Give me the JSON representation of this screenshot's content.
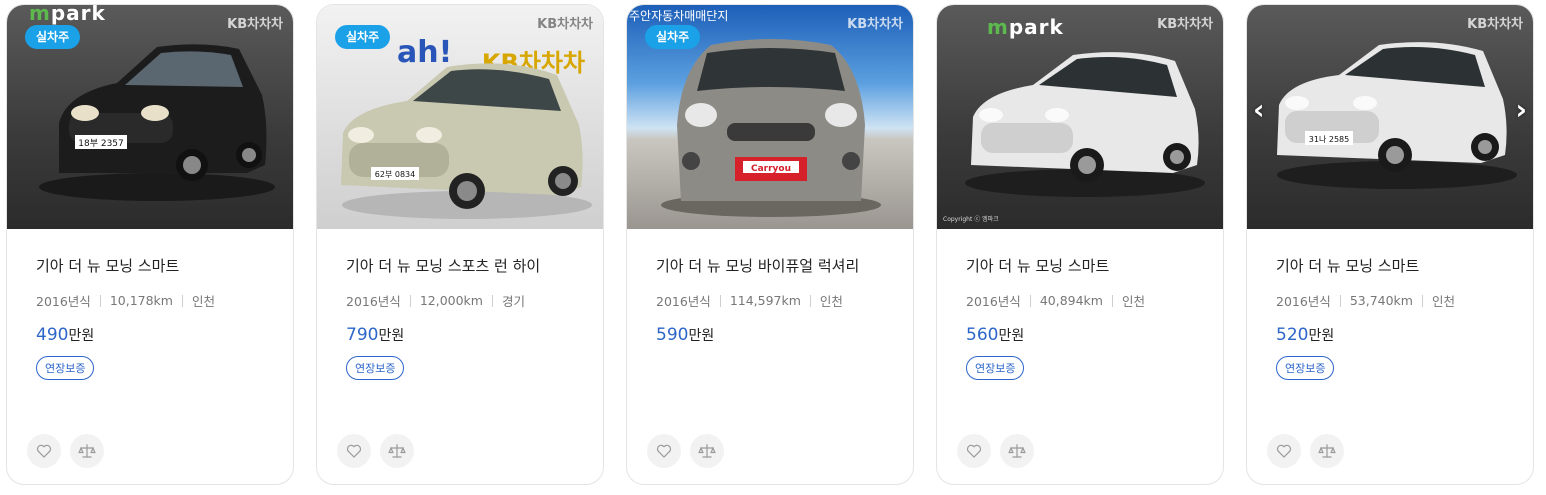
{
  "cards": [
    {
      "badge": "실차주",
      "photo_brand_green": "m",
      "photo_brand_rest": "park",
      "photo_kb": "KB차차차",
      "plate": "18부 2357",
      "title": "기아 더 뉴 모닝 스마트",
      "year": "2016년식",
      "mileage": "10,178km",
      "region": "인천",
      "price": "490",
      "price_unit": "만원",
      "tag": "연장보증",
      "car_color": "#1c1c1c"
    },
    {
      "badge": "실차주",
      "photo_sign_dealer": "ah!",
      "photo_sign_kb": "KB차차차",
      "photo_kb": "KB차차차",
      "plate": "62부 0834",
      "title": "기아 더 뉴 모닝 스포츠 런 하이",
      "year": "2016년식",
      "mileage": "12,000km",
      "region": "경기",
      "price": "790",
      "price_unit": "만원",
      "tag": "연장보증",
      "car_color": "#c9c8b0"
    },
    {
      "badge": "실차주",
      "photo_caption": "주안자동차매매단지",
      "photo_kb": "KB차차차",
      "dealer_plate": "Carryou",
      "title": "기아 더 뉴 모닝 바이퓨얼 럭셔리",
      "year": "2016년식",
      "mileage": "114,597km",
      "region": "인천",
      "price": "590",
      "price_unit": "만원",
      "car_color": "#8d8b86"
    },
    {
      "photo_brand_green": "m",
      "photo_brand_rest": "park",
      "photo_kb": "KB차차차",
      "photo_copyright": "Copyright ⓒ 엠파크",
      "title": "기아 더 뉴 모닝 스마트",
      "year": "2016년식",
      "mileage": "40,894km",
      "region": "인천",
      "price": "560",
      "price_unit": "만원",
      "tag": "연장보증",
      "car_color": "#e8e8e8"
    },
    {
      "photo_kb": "KB차차차",
      "plate": "31나 2585",
      "title": "기아 더 뉴 모닝 스마트",
      "year": "2016년식",
      "mileage": "53,740km",
      "region": "인천",
      "price": "520",
      "price_unit": "만원",
      "tag": "연장보증",
      "car_color": "#e8e8e8",
      "arrow_prev": "‹",
      "arrow_next": "›"
    }
  ],
  "icons": {
    "wishlist": "heart-icon",
    "compare": "scale-icon"
  },
  "colors": {
    "badge": "#1aa1e8",
    "price": "#2c66c9",
    "tag": "#2c66c9"
  }
}
